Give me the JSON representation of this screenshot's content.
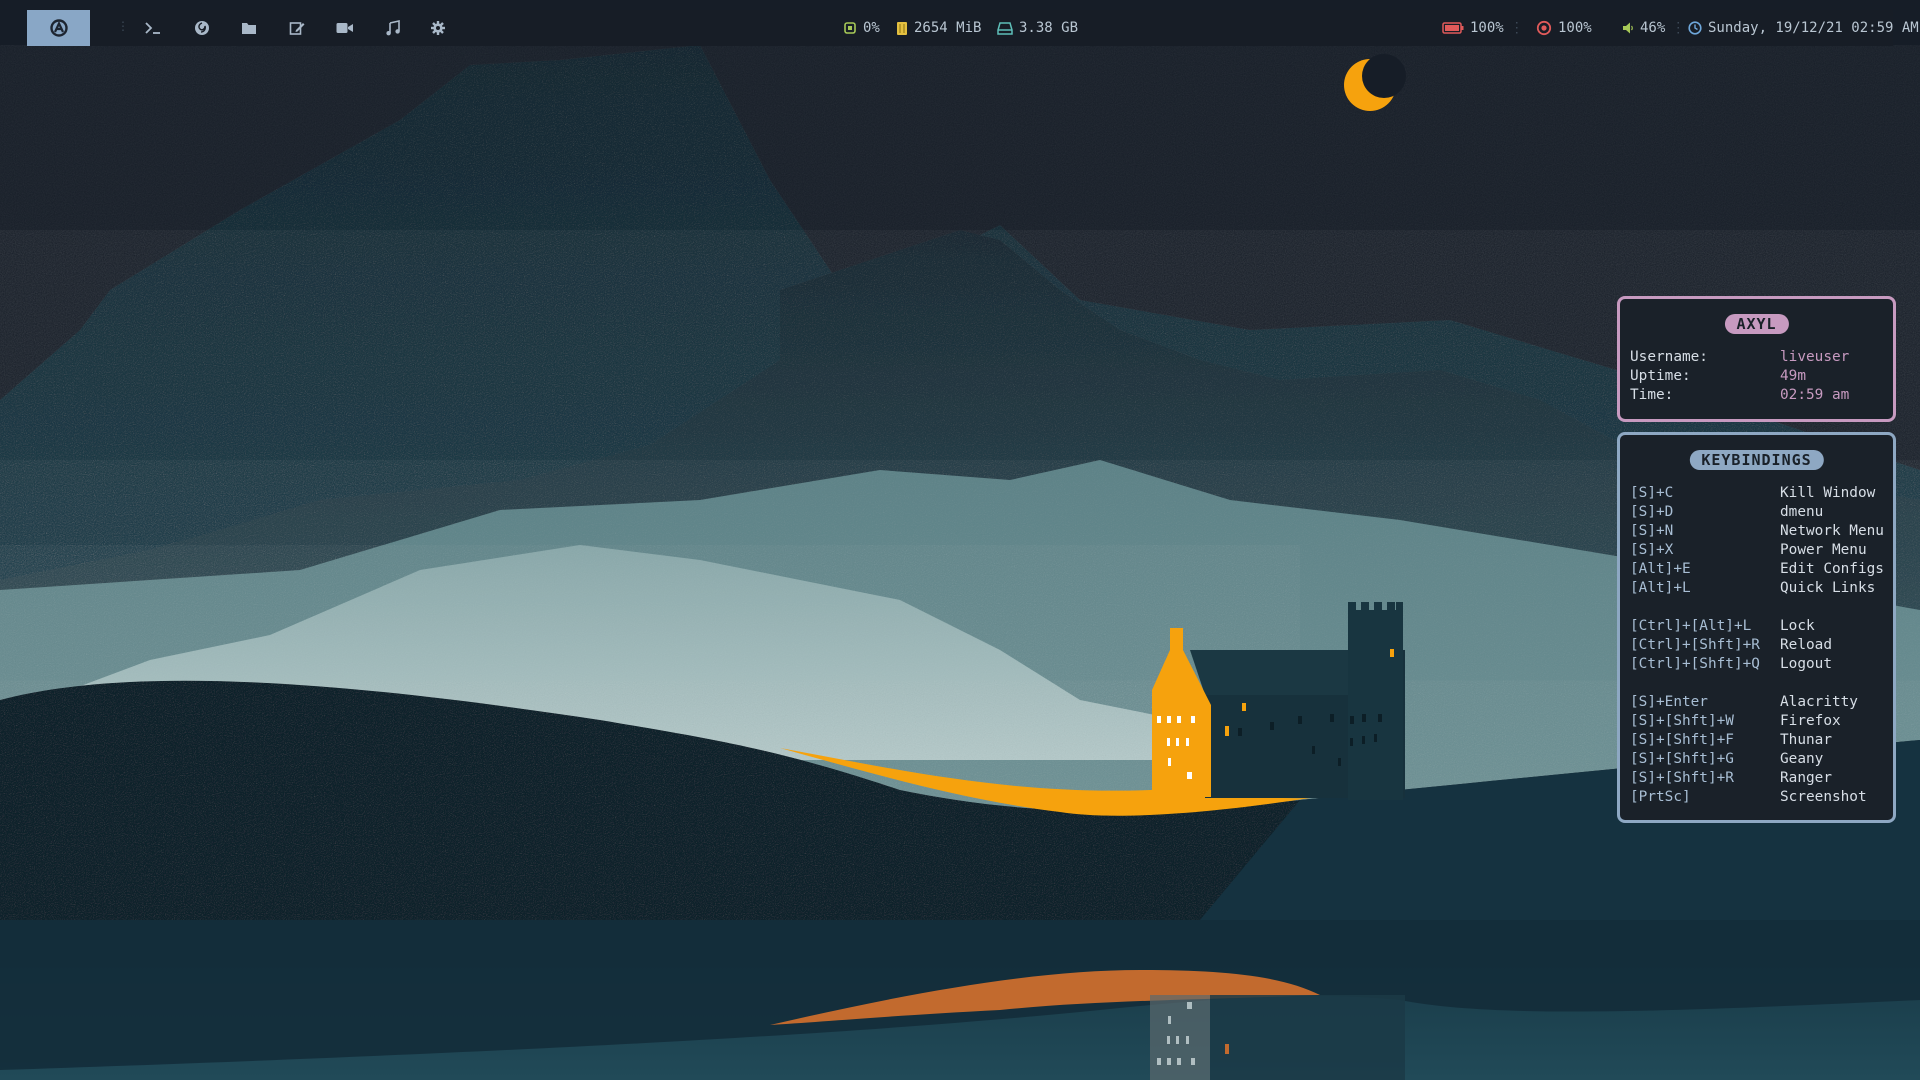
{
  "topbar": {
    "launchers": [
      {
        "name": "terminal-launcher",
        "icon": "terminal-icon"
      },
      {
        "name": "browser-launcher",
        "icon": "firefox-icon"
      },
      {
        "name": "files-launcher",
        "icon": "folder-icon"
      },
      {
        "name": "editor-launcher",
        "icon": "edit-icon"
      },
      {
        "name": "video-launcher",
        "icon": "video-camera-icon"
      },
      {
        "name": "music-launcher",
        "icon": "music-note-icon"
      },
      {
        "name": "settings-launcher",
        "icon": "gear-icon"
      }
    ],
    "cpu": "0%",
    "memory": "2654 MiB",
    "disk": "3.38 GB",
    "battery": "100%",
    "brightness": "100%",
    "volume": "46%",
    "datetime": "Sunday, 19/12/21 02:59 AM"
  },
  "axyl_panel": {
    "title": "AXYL",
    "rows": [
      {
        "label": "Username:",
        "value": "liveuser"
      },
      {
        "label": "Uptime:",
        "value": "49m"
      },
      {
        "label": "Time:",
        "value": "02:59 am"
      }
    ]
  },
  "keys_panel": {
    "title": "KEYBINDINGS",
    "groups": [
      [
        {
          "key": "[S]+C",
          "action": "Kill Window"
        },
        {
          "key": "[S]+D",
          "action": "dmenu"
        },
        {
          "key": "[S]+N",
          "action": "Network Menu"
        },
        {
          "key": "[S]+X",
          "action": "Power Menu"
        },
        {
          "key": "[Alt]+E",
          "action": "Edit Configs"
        },
        {
          "key": "[Alt]+L",
          "action": "Quick Links"
        }
      ],
      [
        {
          "key": "[Ctrl]+[Alt]+L",
          "action": "Lock"
        },
        {
          "key": "[Ctrl]+[Shft]+R",
          "action": "Reload"
        },
        {
          "key": "[Ctrl]+[Shft]+Q",
          "action": "Logout"
        }
      ],
      [
        {
          "key": "[S]+Enter",
          "action": "Alacritty"
        },
        {
          "key": "[S]+[Shft]+W",
          "action": "Firefox"
        },
        {
          "key": "[S]+[Shft]+F",
          "action": "Thunar"
        },
        {
          "key": "[S]+[Shft]+G",
          "action": "Geany"
        },
        {
          "key": "[S]+[Shft]+R",
          "action": "Ranger"
        },
        {
          "key": "[PrtSc]",
          "action": "Screenshot"
        }
      ]
    ]
  },
  "colors": {
    "accent_blue": "#8ea8c3",
    "accent_pink": "#c79ac0",
    "orange": "#f59e0b",
    "bar_bg": "#171d26"
  }
}
